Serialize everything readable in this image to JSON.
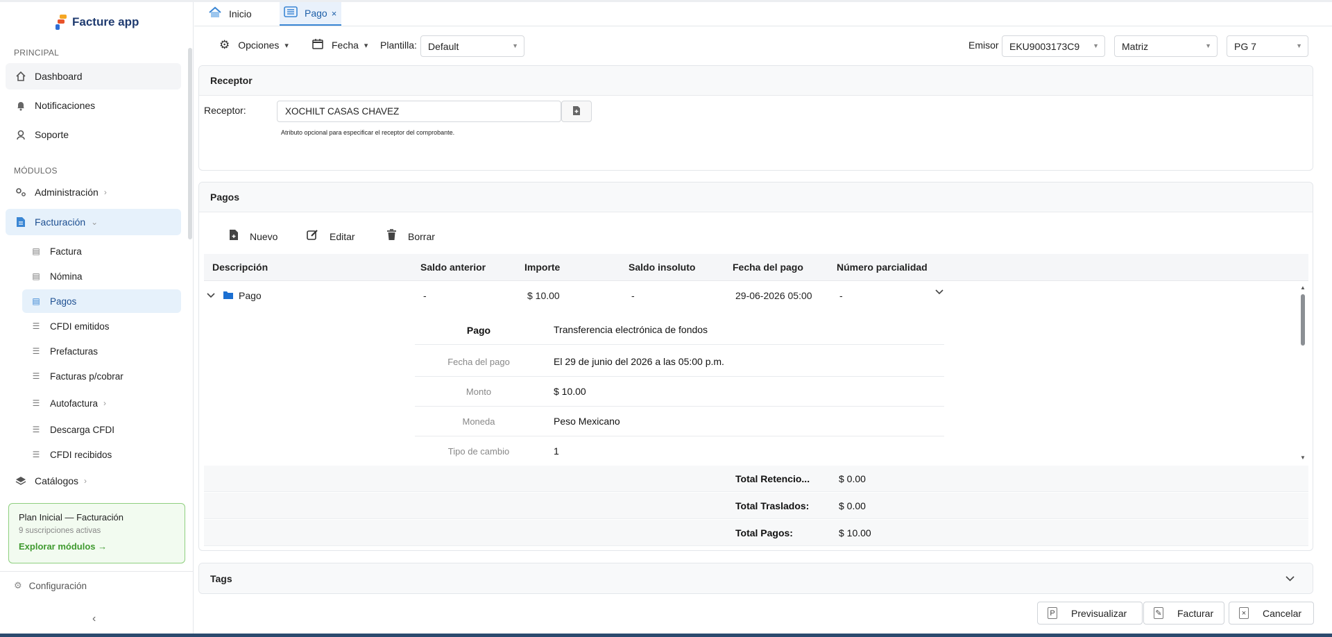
{
  "app": {
    "name": "Facture app",
    "brand_color": "#1f3b70",
    "accent": "#3a86d4"
  },
  "sidebar": {
    "sections": {
      "principal": "PRINCIPAL",
      "modulos": "MÓDULOS"
    },
    "principal_items": [
      {
        "label": "Dashboard",
        "icon": "home-icon"
      },
      {
        "label": "Notificaciones",
        "icon": "bell-icon"
      },
      {
        "label": "Soporte",
        "icon": "support-icon"
      }
    ],
    "modules": [
      {
        "label": "Administración",
        "icon": "gears-icon"
      },
      {
        "label": "Facturación",
        "icon": "invoice-icon"
      }
    ],
    "facturacion_items": [
      {
        "label": "Factura"
      },
      {
        "label": "Nómina"
      },
      {
        "label": "Pagos"
      },
      {
        "label": "CFDI emitidos"
      },
      {
        "label": "Prefacturas"
      },
      {
        "label": "Facturas p/cobrar"
      },
      {
        "label": "Autofactura"
      },
      {
        "label": "Descarga CFDI"
      },
      {
        "label": "CFDI recibidos"
      }
    ],
    "catalogos": "Catálogos",
    "plan": {
      "title": "Plan Inicial — Facturación",
      "subtitle": "9 suscripciones activas",
      "link": "Explorar módulos →"
    },
    "configuracion": "Configuración"
  },
  "tabs": [
    {
      "label": "Inicio",
      "icon": "home-icon"
    },
    {
      "label": "Pago",
      "icon": "list-icon",
      "close": "×"
    }
  ],
  "toolbar": {
    "opciones": "Opciones",
    "fecha": "Fecha",
    "plantilla_label": "Plantilla:",
    "plantilla_value": "Default",
    "emisor_label": "Emisor",
    "emisor_value": "EKU9003173C9",
    "sucursal_value": "Matriz",
    "serie_value": "PG 7"
  },
  "receptor": {
    "panel_title": "Receptor",
    "label": "Receptor:",
    "value": "XOCHILT CASAS CHAVEZ",
    "hint": "Atributo opcional para especificar el receptor del comprobante."
  },
  "pagos": {
    "panel_title": "Pagos",
    "actions": {
      "nuevo": "Nuevo",
      "editar": "Editar",
      "borrar": "Borrar"
    },
    "columns": [
      "Descripción",
      "Saldo anterior",
      "Importe",
      "Saldo insoluto",
      "Fecha del pago",
      "Número parcialidad"
    ],
    "row": {
      "descripcion": "Pago",
      "saldo_anterior": "-",
      "importe": "$ 10.00",
      "saldo_insoluto": "-",
      "fecha_pago": "29-06-2026 05:00",
      "numero_parcialidad": "-"
    },
    "detail": [
      {
        "label": "Pago",
        "value": "Transferencia electrónica de fondos"
      },
      {
        "label": "Fecha del pago",
        "value": "El 29 de junio del 2026 a las 05:00 p.m."
      },
      {
        "label": "Monto",
        "value": "$ 10.00"
      },
      {
        "label": "Moneda",
        "value": "Peso Mexicano"
      },
      {
        "label": "Tipo de cambio",
        "value": "1"
      }
    ],
    "totals": [
      {
        "label": "Total Retencio...",
        "value": "$ 0.00"
      },
      {
        "label": "Total Traslados:",
        "value": "$ 0.00"
      },
      {
        "label": "Total Pagos:",
        "value": "$ 10.00"
      }
    ]
  },
  "tags": {
    "panel_title": "Tags"
  },
  "footer": {
    "previsualizar": "Previsualizar",
    "facturar": "Facturar",
    "cancelar": "Cancelar"
  }
}
